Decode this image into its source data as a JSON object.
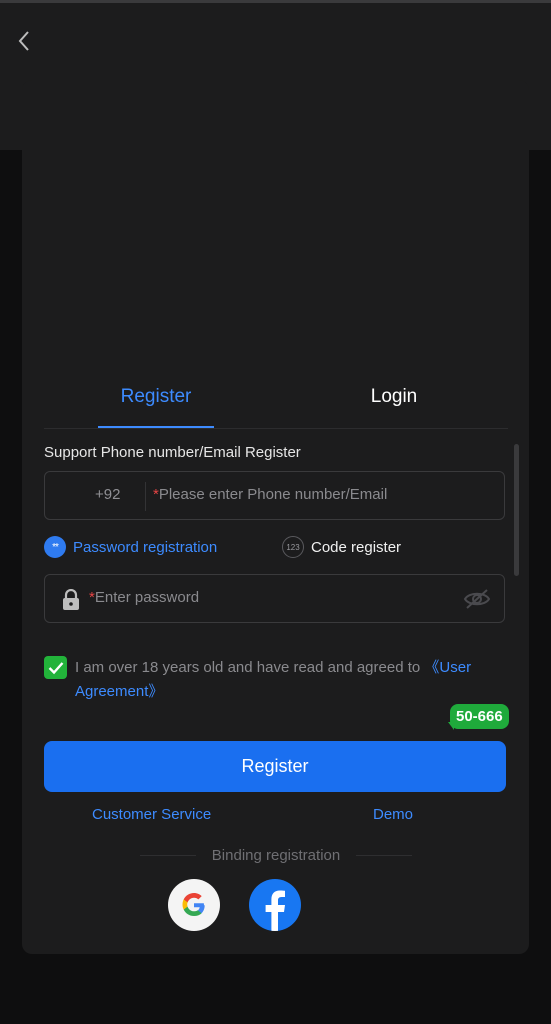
{
  "tabs": {
    "register": "Register",
    "login": "Login"
  },
  "form": {
    "support_label": "Support Phone number/Email Register",
    "country_code": "+92",
    "required_mark": "*",
    "phone_placeholder": "Please enter Phone number/Email",
    "password_placeholder": "Enter password",
    "mode_password": "Password registration",
    "mode_code": "Code register",
    "code_badge": "123",
    "password_badge": "**",
    "agree_text": "I am over 18 years old and have read and agreed to ",
    "agree_link": "《User Agreement》",
    "checkbox_checked": true
  },
  "bubble": "50-666",
  "register_button": "Register",
  "links": {
    "customer_service": "Customer Service",
    "demo": "Demo"
  },
  "binding": {
    "label": "Binding registration"
  },
  "colors": {
    "accent": "#3d8bff",
    "button": "#1a6ff0",
    "check": "#22b33a",
    "bubble": "#1faa3b",
    "required": "#e64545"
  },
  "icons": [
    "back-arrow-icon",
    "lock-icon",
    "eye-off-icon",
    "check-icon",
    "google-icon",
    "facebook-icon"
  ]
}
